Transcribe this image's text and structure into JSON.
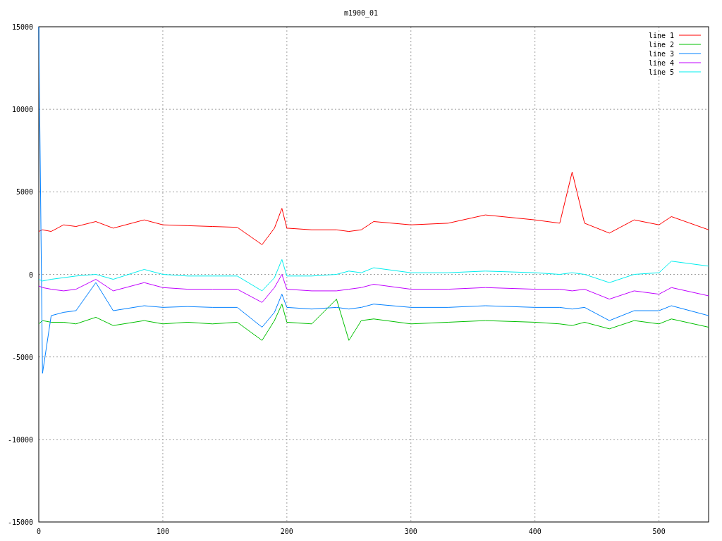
{
  "chart": {
    "chart_data": {
      "type": "line",
      "title": "m1900_01",
      "x": [
        0,
        3,
        10,
        20,
        30,
        46,
        60,
        85,
        100,
        120,
        140,
        160,
        180,
        190,
        196,
        200,
        220,
        240,
        250,
        260,
        270,
        300,
        330,
        360,
        400,
        420,
        430,
        440,
        460,
        480,
        500,
        510,
        540
      ],
      "series": [
        {
          "name": "line 1",
          "color": "#ff0000",
          "values": [
            2600,
            2700,
            2600,
            3000,
            2900,
            3200,
            2800,
            3300,
            3000,
            2950,
            2900,
            2850,
            1800,
            2800,
            4000,
            2800,
            2700,
            2700,
            2600,
            2700,
            3200,
            3000,
            3100,
            3600,
            3300,
            3100,
            6200,
            3100,
            2500,
            3300,
            3000,
            3500,
            2700
          ]
        },
        {
          "name": "line 2",
          "color": "#00c000",
          "values": [
            -3000,
            -2800,
            -2900,
            -2900,
            -3000,
            -2600,
            -3100,
            -2800,
            -3000,
            -2900,
            -3000,
            -2900,
            -4000,
            -2800,
            -1800,
            -2900,
            -3000,
            -1500,
            -4000,
            -2800,
            -2700,
            -3000,
            -2900,
            -2800,
            -2900,
            -3000,
            -3100,
            -2900,
            -3300,
            -2800,
            -3000,
            -2700,
            -3200
          ]
        },
        {
          "name": "line 3",
          "color": "#0080ff",
          "values": [
            15000,
            -6000,
            -2500,
            -2300,
            -2200,
            -500,
            -2200,
            -1900,
            -2000,
            -1950,
            -2000,
            -2000,
            -3200,
            -2300,
            -1200,
            -2000,
            -2100,
            -2000,
            -2100,
            -2000,
            -1800,
            -2000,
            -2000,
            -1900,
            -2000,
            -2000,
            -2100,
            -2000,
            -2800,
            -2200,
            -2200,
            -1900,
            -2500
          ]
        },
        {
          "name": "line 4",
          "color": "#c000ff",
          "values": [
            -700,
            -800,
            -900,
            -1000,
            -900,
            -300,
            -1000,
            -500,
            -800,
            -900,
            -900,
            -900,
            -1700,
            -800,
            0,
            -900,
            -1000,
            -1000,
            -900,
            -800,
            -600,
            -900,
            -900,
            -800,
            -900,
            -900,
            -1000,
            -900,
            -1500,
            -1000,
            -1200,
            -800,
            -1300
          ]
        },
        {
          "name": "line 5",
          "color": "#00eeee",
          "values": [
            -300,
            -400,
            -300,
            -200,
            -100,
            0,
            -300,
            300,
            0,
            -100,
            -100,
            -100,
            -1000,
            -200,
            900,
            -100,
            -100,
            0,
            200,
            100,
            400,
            100,
            100,
            200,
            100,
            0,
            100,
            0,
            -500,
            0,
            100,
            800,
            500
          ]
        }
      ],
      "grid": true,
      "legend": true,
      "xlim": [
        0,
        540
      ],
      "ylim": [
        -15000,
        15000
      ],
      "xticks": [
        0,
        100,
        200,
        300,
        400,
        500
      ],
      "yticks": [
        -15000,
        -10000,
        -5000,
        0,
        5000,
        10000,
        15000
      ]
    }
  }
}
